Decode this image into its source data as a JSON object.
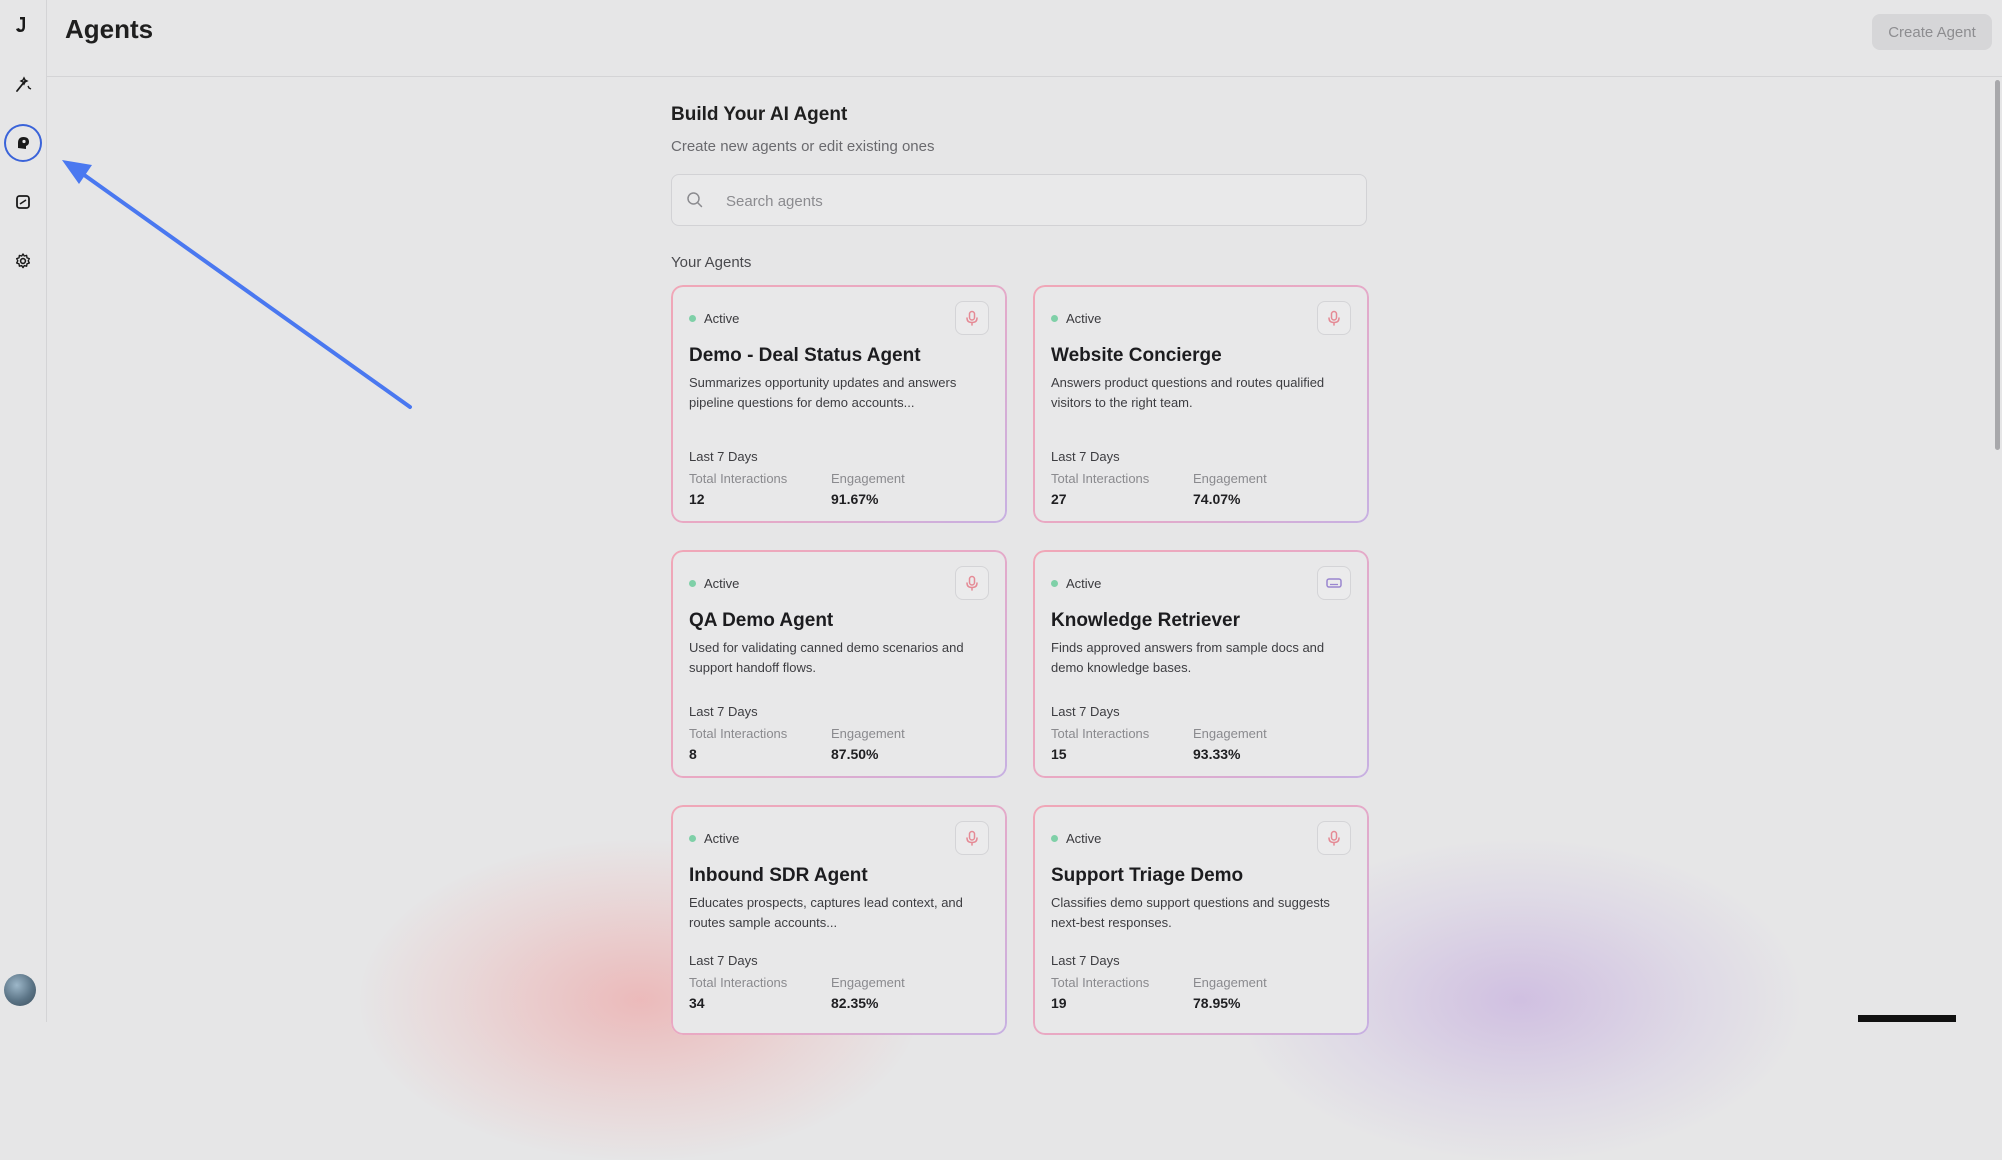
{
  "app": {
    "page_title": "Agents",
    "create_button": "Create Agent"
  },
  "sidebar": {
    "items": [
      {
        "name": "logo",
        "icon": "logo-icon"
      },
      {
        "name": "workflows",
        "icon": "magic-wand-icon"
      },
      {
        "name": "agents",
        "icon": "agent-head-icon",
        "active": true
      },
      {
        "name": "knowledge",
        "icon": "document-icon"
      },
      {
        "name": "settings",
        "icon": "gear-icon"
      }
    ],
    "avatar": "user-avatar"
  },
  "main": {
    "heading": "Build Your AI Agent",
    "subheading": "Create new agents or edit existing ones",
    "search_placeholder": "Search agents",
    "section_title": "Your Agents",
    "agents": [
      {
        "status": "Active",
        "type_icon": "microphone-icon",
        "title": "Demo - Deal Status Agent",
        "description": "Summarizes opportunity updates and answers pipeline questions for demo accounts...",
        "period": "Last 7 Days",
        "interactions_label": "Total Interactions",
        "interactions": "12",
        "engagement_label": "Engagement",
        "engagement": "91.67%"
      },
      {
        "status": "Active",
        "type_icon": "microphone-icon",
        "title": "Website Concierge",
        "description": "Answers product questions and routes qualified visitors to the right team.",
        "period": "Last 7 Days",
        "interactions_label": "Total Interactions",
        "interactions": "27",
        "engagement_label": "Engagement",
        "engagement": "74.07%"
      },
      {
        "status": "Active",
        "type_icon": "microphone-icon",
        "title": "QA Demo Agent",
        "description": "Used for validating canned demo scenarios and support handoff flows.",
        "period": "Last 7 Days",
        "interactions_label": "Total Interactions",
        "interactions": "8",
        "engagement_label": "Engagement",
        "engagement": "87.50%"
      },
      {
        "status": "Active",
        "type_icon": "keyboard-icon",
        "title": "Knowledge Retriever",
        "description": "Finds approved answers from sample docs and demo knowledge bases.",
        "period": "Last 7 Days",
        "interactions_label": "Total Interactions",
        "interactions": "15",
        "engagement_label": "Engagement",
        "engagement": "93.33%"
      },
      {
        "status": "Active",
        "type_icon": "microphone-icon",
        "title": "Inbound SDR Agent",
        "description": "Educates prospects, captures lead context, and routes sample accounts...",
        "period": "Last 7 Days",
        "interactions_label": "Total Interactions",
        "interactions": "34",
        "engagement_label": "Engagement",
        "engagement": "82.35%"
      },
      {
        "status": "Active",
        "type_icon": "microphone-icon",
        "title": "Support Triage Demo",
        "description": "Classifies demo support questions and suggests next-best responses.",
        "period": "Last 7 Days",
        "interactions_label": "Total Interactions",
        "interactions": "19",
        "engagement_label": "Engagement",
        "engagement": "78.95%"
      }
    ]
  },
  "colors": {
    "accent_blue": "#3a63d9",
    "active_dot": "#7fd0a8",
    "mic_icon": "#e58a95",
    "keyboard_icon": "#9a86cf",
    "annotation_arrow": "#4a78f0"
  }
}
